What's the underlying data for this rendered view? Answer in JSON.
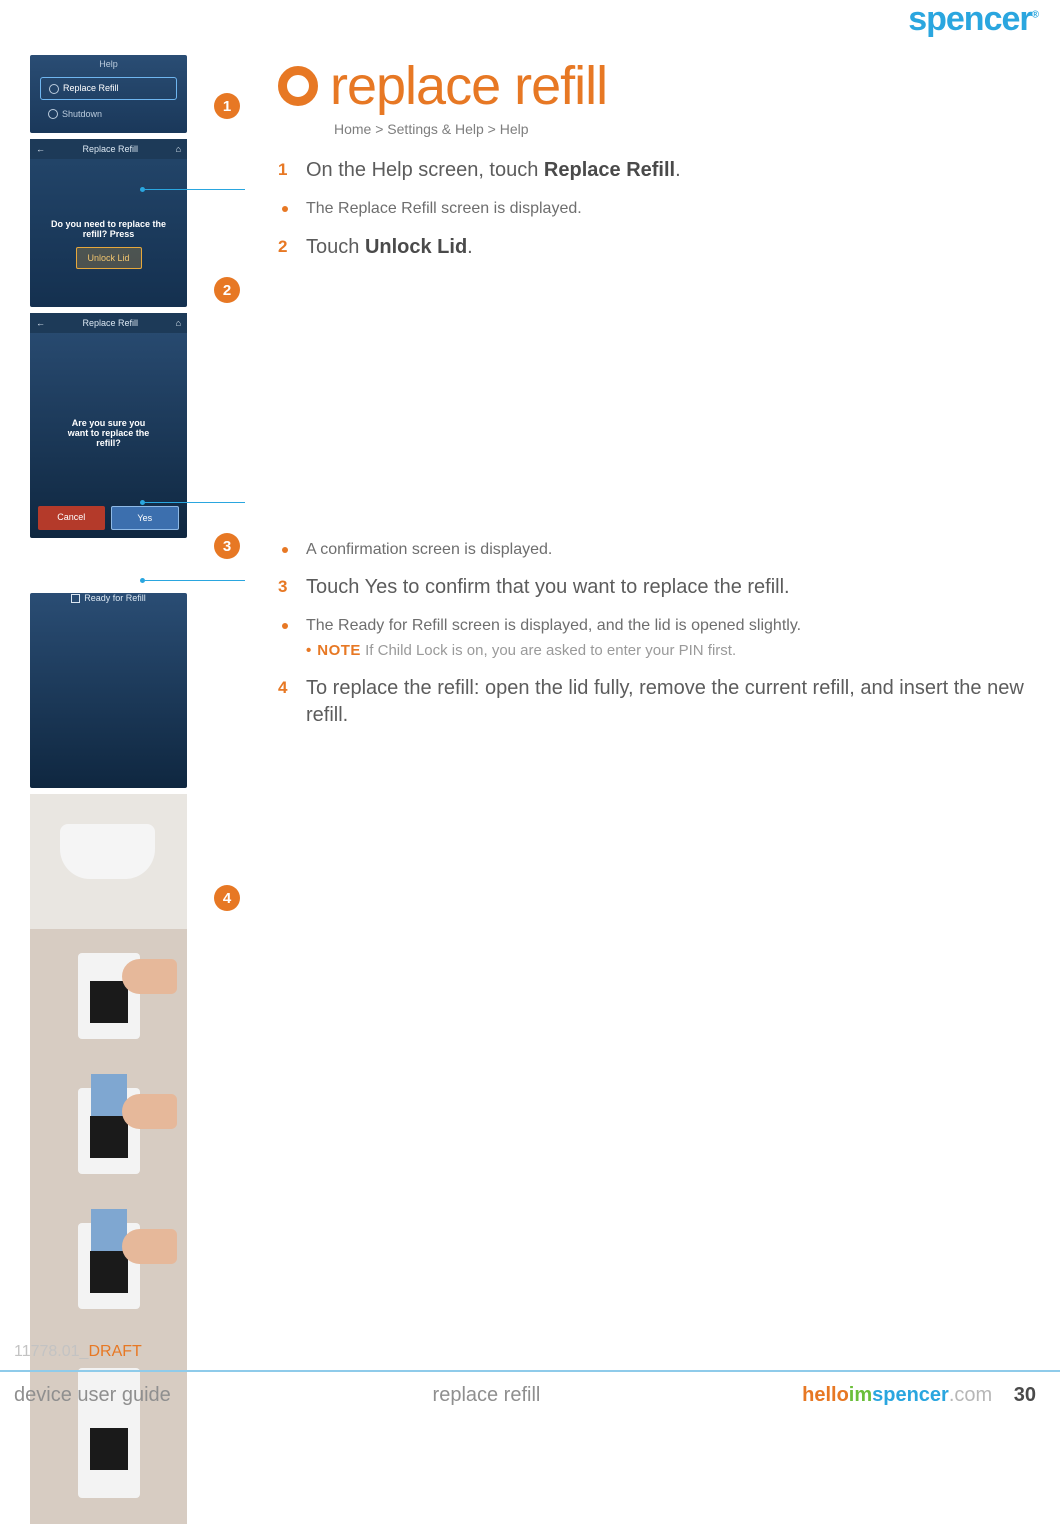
{
  "brand": "spencer",
  "brand_reg": "®",
  "title": "replace refill",
  "breadcrumb": "Home > Settings & Help > Help",
  "badges": {
    "b1": "1",
    "b2": "2",
    "b3": "3",
    "b4": "4"
  },
  "shot1": {
    "header": "Help",
    "row1": "Replace Refill",
    "row2": "Shutdown"
  },
  "shot2": {
    "header": "Replace Refill",
    "prompt_l1": "Do you need to replace the",
    "prompt_l2": "refill? Press",
    "button": "Unlock Lid"
  },
  "shot3": {
    "header": "Replace Refill",
    "prompt_l1": "Are you sure you",
    "prompt_l2": "want to replace the",
    "prompt_l3": "refill?",
    "cancel": "Cancel",
    "yes": "Yes"
  },
  "shot4": {
    "ready": "Ready for Refill"
  },
  "steps": {
    "s1_num": "1",
    "s1_pre": "On the Help screen, touch ",
    "s1_bold": "Replace Refill",
    "s1_post": ".",
    "b1": "The Replace Refill screen is displayed.",
    "s2_num": "2",
    "s2_pre": "Touch ",
    "s2_bold": "Unlock Lid",
    "s2_post": ".",
    "b2": "A confirmation screen is displayed.",
    "s3_num": "3",
    "s3_text": "Touch Yes to confirm that you want to replace the refill.",
    "b3": "The Ready for Refill screen is displayed, and the lid is opened slightly.",
    "note_bullet": "•",
    "note_label": "NOTE",
    "note_text": "  If Child Lock is on, you are asked to enter your PIN first.",
    "s4_num": "4",
    "s4_text": "To replace the refill: open the lid fully, remove the current refill, and insert the new refill."
  },
  "docid_prefix": "11778.01_",
  "docid_draft": "DRAFT",
  "footer": {
    "left": "device user guide",
    "center": "replace refill",
    "url_h": "hello",
    "url_i": "im",
    "url_s": "spencer",
    "url_c": ".com",
    "page": "30"
  }
}
